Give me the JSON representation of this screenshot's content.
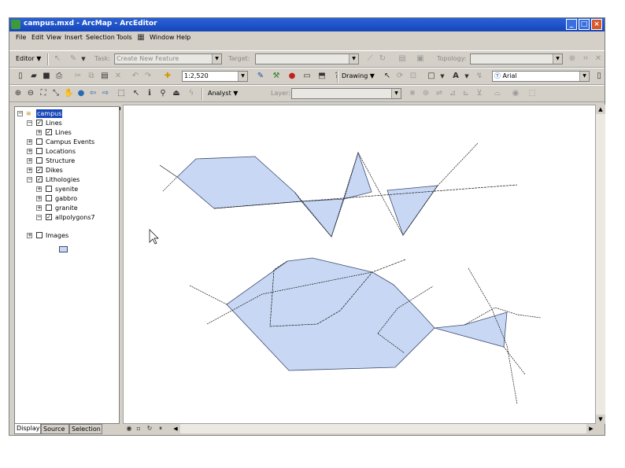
{
  "window": {
    "title": "campus.mxd - ArcMap - ArcEditor"
  },
  "menu": [
    "File",
    "Edit",
    "View",
    "Insert",
    "Selection",
    "Tools",
    "Window",
    "Help"
  ],
  "editor_toolbar": {
    "editor_label": "Editor ▼",
    "task_label": "Task:",
    "task_value": "Create New Feature",
    "target_label": "Target:",
    "target_value": "",
    "topology_label": "Topology:",
    "topology_value": ""
  },
  "standard_toolbar": {
    "scale_value": "1:2,520",
    "drawing_label": "Drawing ▼",
    "font_value": "Arial"
  },
  "georef_toolbar": {
    "analyst_label": "Analyst ▼",
    "layer_label": "Layer:",
    "layer_value": ""
  },
  "toc": {
    "data_frame": "campus",
    "layers": [
      {
        "label": "Lines",
        "indent": 1,
        "expanded": true,
        "checked": true
      },
      {
        "label": "Lines",
        "indent": 2,
        "expanded": false,
        "checked": true
      },
      {
        "label": "Campus Events",
        "indent": 1,
        "expanded": false,
        "checked": false
      },
      {
        "label": "Locations",
        "indent": 1,
        "expanded": false,
        "checked": false
      },
      {
        "label": "Structure",
        "indent": 1,
        "expanded": false,
        "checked": false
      },
      {
        "label": "Dikes",
        "indent": 1,
        "expanded": false,
        "checked": true
      },
      {
        "label": "Lithologies",
        "indent": 1,
        "expanded": true,
        "checked": true
      },
      {
        "label": "syenite",
        "indent": 2,
        "expanded": false,
        "checked": false
      },
      {
        "label": "gabbro",
        "indent": 2,
        "expanded": false,
        "checked": false
      },
      {
        "label": "granite",
        "indent": 2,
        "expanded": false,
        "checked": false
      },
      {
        "label": "allpolygons7",
        "indent": 2,
        "expanded": true,
        "checked": true
      },
      {
        "label": "Images",
        "indent": 1,
        "expanded": false,
        "checked": false
      }
    ],
    "tabs": [
      "Display",
      "Source",
      "Selection"
    ]
  },
  "colors": {
    "polygon_fill": "#c8d8f4",
    "polygon_stroke": "#3c4a6e",
    "line": "#111111",
    "titlebar": "#2a62d8"
  }
}
